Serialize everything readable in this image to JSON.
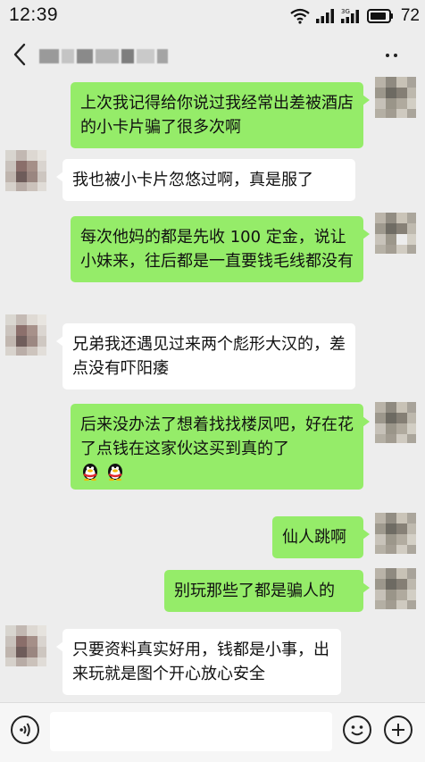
{
  "status_bar": {
    "time": "12:39",
    "battery": "72",
    "network_label": "3G"
  },
  "header": {
    "back_icon": "chevron-left-icon",
    "more_icon": "more-dots-icon"
  },
  "messages": [
    {
      "side": "right",
      "text": "上次我记得给你说过我经常出差被酒店的小卡片骗了很多次啊"
    },
    {
      "side": "left",
      "text": "我也被小卡片忽悠过啊，真是服了"
    },
    {
      "side": "right",
      "text": "每次他妈的都是先收 100 定金，说让小妹来，往后都是一直要钱毛线都没有"
    },
    {
      "side": "left",
      "text": "兄弟我还遇见过来两个彪形大汉的，差点没有吓阳痿"
    },
    {
      "side": "right",
      "text": "后来没办法了想着找找楼凤吧，好在花了点钱在这家伙这买到真的了",
      "emoji": [
        "qq-penguin-icon",
        "qq-penguin-icon"
      ]
    },
    {
      "side": "right",
      "text": "仙人跳啊"
    },
    {
      "side": "right",
      "text": "别玩那些了都是骗人的"
    },
    {
      "side": "left",
      "text": "只要资料真实好用，钱都是小事，出来玩就是图个开心放心安全"
    }
  ],
  "input_bar": {
    "voice_icon": "voice-icon",
    "emoji_icon": "smiley-icon",
    "plus_icon": "plus-icon",
    "input_value": ""
  },
  "colors": {
    "background": "#ededed",
    "right_bubble": "#95ec69",
    "left_bubble": "#ffffff"
  }
}
